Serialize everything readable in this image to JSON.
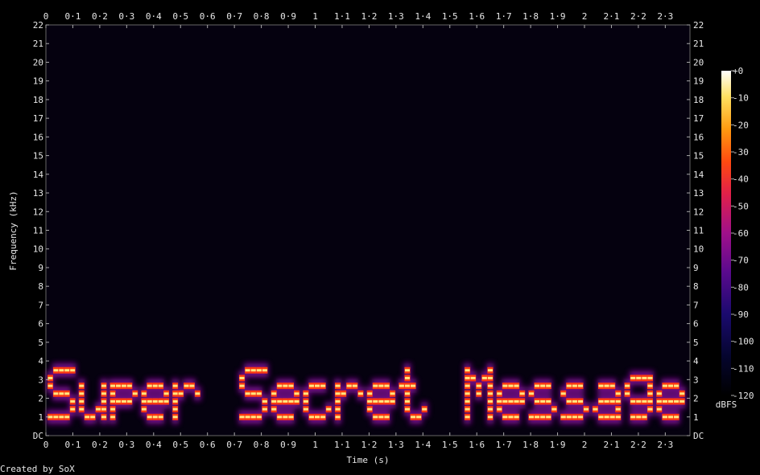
{
  "chart_data": {
    "type": "heatmap",
    "xlabel": "Time (s)",
    "ylabel": "Frequency (kHz)",
    "xlim": [
      0,
      2.39
    ],
    "ylim": [
      0,
      22
    ],
    "x_ticks": [
      "0",
      "0·1",
      "0·2",
      "0·3",
      "0·4",
      "0·5",
      "0·6",
      "0·7",
      "0·8",
      "0·9",
      "1",
      "1·1",
      "1·2",
      "1·3",
      "1·4",
      "1·5",
      "1·6",
      "1·7",
      "1·8",
      "1·9",
      "2",
      "2·1",
      "2·2",
      "2·3"
    ],
    "y_ticks": [
      "DC",
      "1",
      "2",
      "3",
      "4",
      "5",
      "6",
      "7",
      "8",
      "9",
      "10",
      "11",
      "12",
      "13",
      "14",
      "15",
      "16",
      "17",
      "18",
      "19",
      "20",
      "21",
      "22"
    ],
    "colorbar": {
      "label": "dBFS",
      "ticks": [
        "+0",
        "-10",
        "-20",
        "-30",
        "-40",
        "-50",
        "-60",
        "-70",
        "-80",
        "-90",
        "-100",
        "-110",
        "-120"
      ],
      "range": [
        -120,
        0
      ]
    },
    "hidden_message": "Super Secret Message",
    "tone_bands_khz": [
      1.0,
      1.5,
      2.0,
      2.5,
      3.0,
      3.5
    ]
  },
  "footer": {
    "text": "Created by SoX"
  },
  "colors": {
    "background": "#000000",
    "plot_background": "#05010f",
    "tone_core": "#ffe680",
    "tone_mid": "#ff3a10",
    "tone_glow": "#7a0a90",
    "text": "#e8e8e8"
  }
}
